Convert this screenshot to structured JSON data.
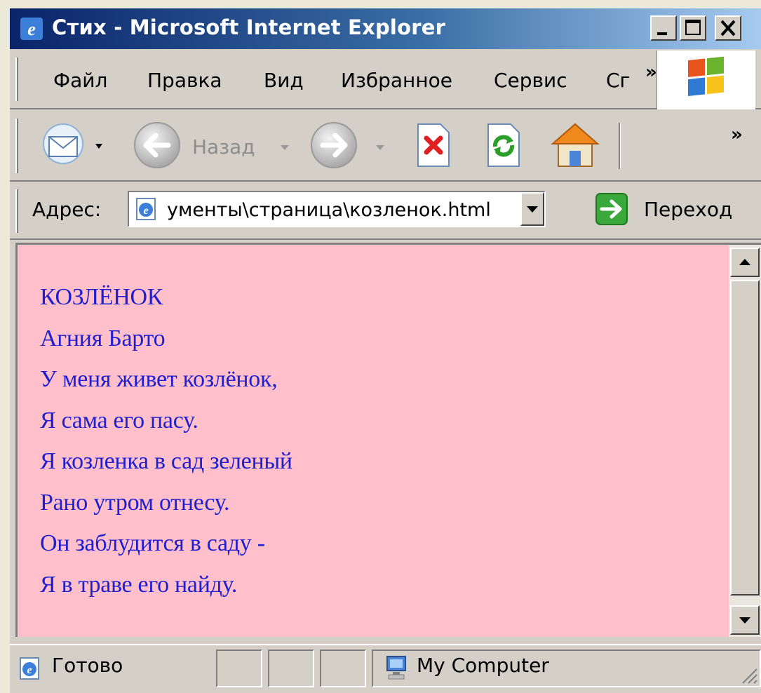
{
  "window": {
    "title": "Стих - Microsoft Internet Explorer",
    "minimize_label": "_",
    "maximize_label": "□",
    "close_label": "✕"
  },
  "menubar": {
    "items": [
      {
        "label": "Файл"
      },
      {
        "label": "Правка"
      },
      {
        "label": "Вид"
      },
      {
        "label": "Избранное"
      },
      {
        "label": "Сервис"
      },
      {
        "label": "Сг"
      }
    ],
    "overflow_label": "»"
  },
  "toolbar": {
    "back_label": "Назад",
    "overflow_label": "»"
  },
  "addressbar": {
    "label": "Адрес:",
    "value": "ументы\\страница\\козленок.html",
    "go_label": "Переход"
  },
  "page": {
    "background": "#ffc0cb",
    "text_color": "#1f1fd0",
    "lines": [
      "КОЗЛЁНОК",
      "Агния Барто",
      "У меня живет козлёнок,",
      "Я сама его пасу.",
      "Я козленка в сад зеленый",
      "Рано утром отнесу.",
      "Он заблудится в саду -",
      "Я в траве его найду."
    ]
  },
  "statusbar": {
    "status": "Готово",
    "zone": "My Computer"
  }
}
